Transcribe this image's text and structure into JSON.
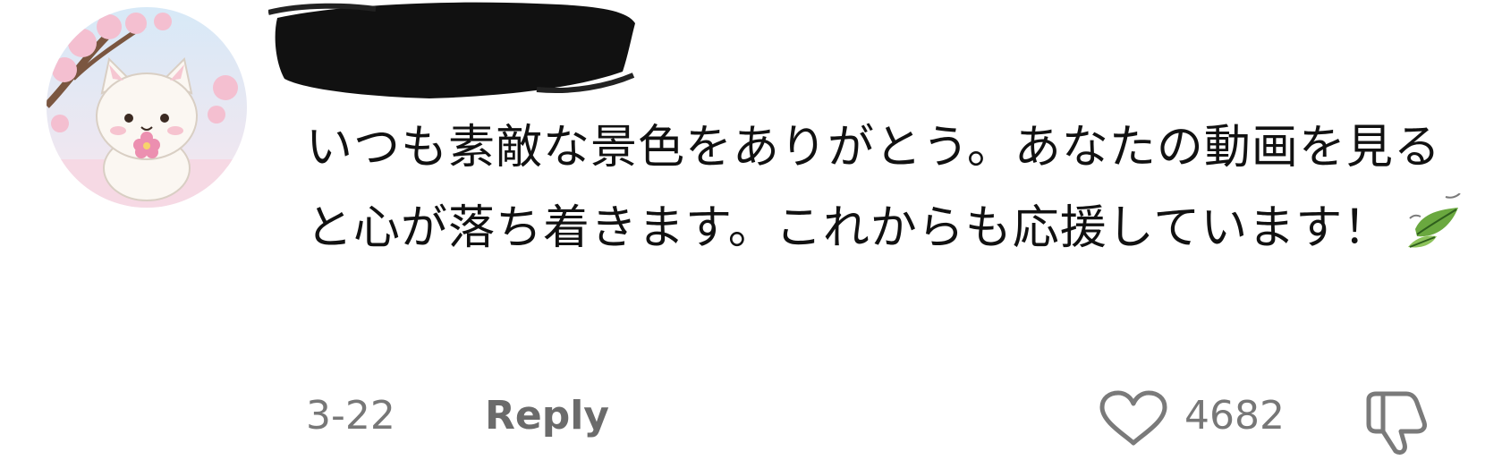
{
  "comment": {
    "avatar_icon": "cat-avatar-icon",
    "username_obscured": true,
    "text": "いつも素敵な景色をありがとう。あなたの動画を見ると心が落ち着きます。これからも応援しています！",
    "emoji": "🍃",
    "date": "3-22",
    "reply_label": "Reply",
    "like_icon": "heart-icon",
    "like_count": "4682",
    "dislike_icon": "thumbs-down-icon"
  },
  "colors": {
    "text": "#111111",
    "meta": "#777777",
    "reply": "#6b6b6b",
    "icon": "#7a7a7a",
    "leaf": "#5f9d3a"
  }
}
